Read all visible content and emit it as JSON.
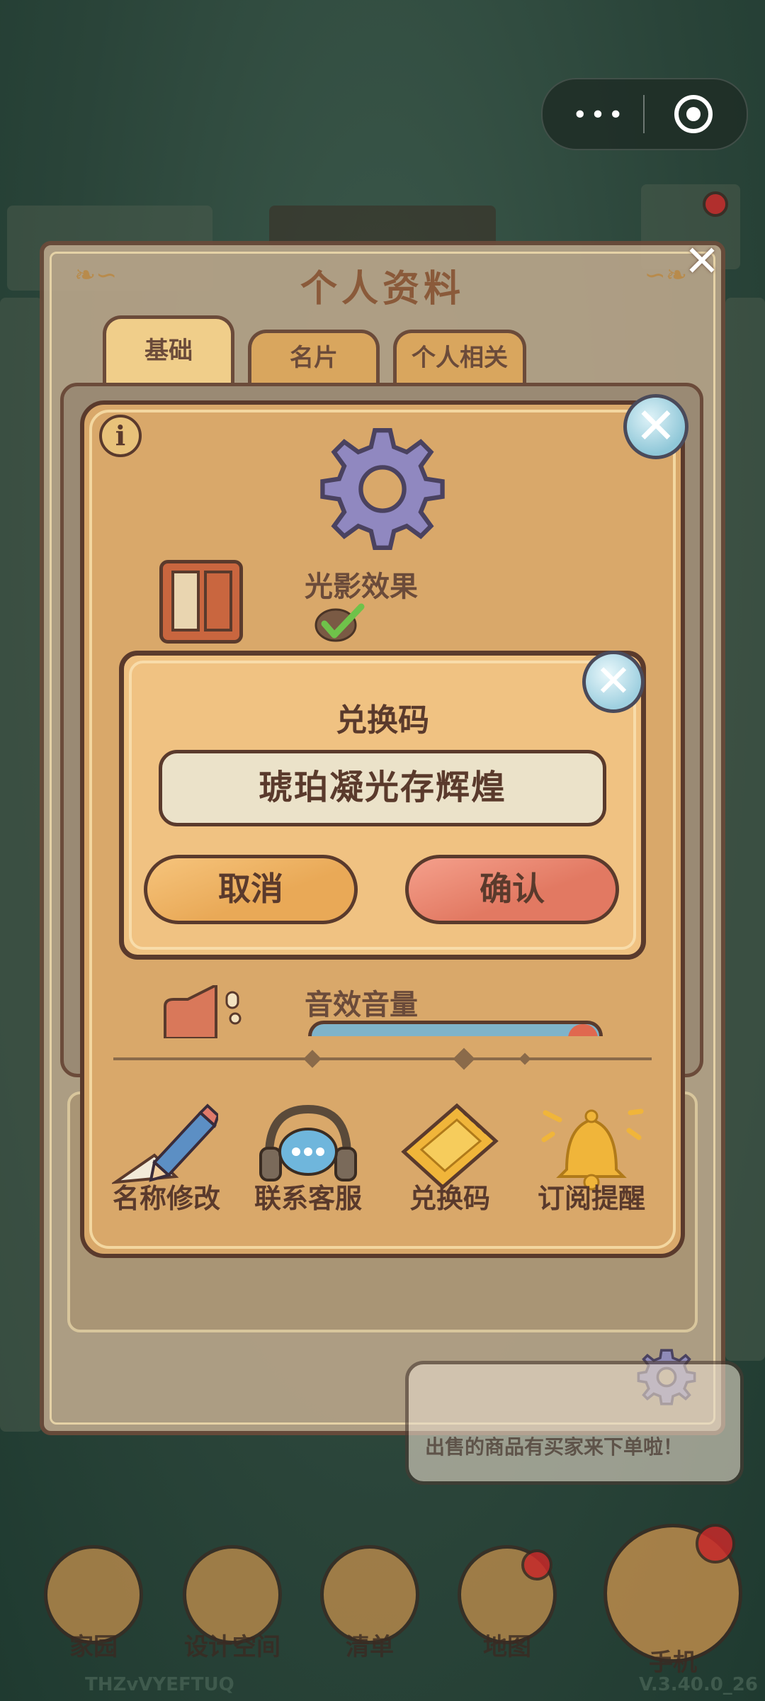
{
  "capsule": {
    "menu_icon": "more-dots-icon",
    "close_icon": "target-icon",
    "dots": "•••"
  },
  "profile": {
    "title": "个人资料",
    "tabs": [
      {
        "label": "基础",
        "active": true
      },
      {
        "label": "名片",
        "active": false
      },
      {
        "label": "个人相关",
        "active": false
      }
    ]
  },
  "settings": {
    "light_label": "光影效果",
    "light_enabled": true,
    "sound_label": "音效音量",
    "sound_volume_percent": 95,
    "features": [
      {
        "label": "名称修改",
        "icon": "pencil-icon"
      },
      {
        "label": "联系客服",
        "icon": "headset-icon"
      },
      {
        "label": "兑换码",
        "icon": "ticket-icon"
      },
      {
        "label": "订阅提醒",
        "icon": "bell-icon"
      }
    ]
  },
  "redeem": {
    "title": "兑换码",
    "code_value": "琥珀凝光存辉煌",
    "cancel_label": "取消",
    "confirm_label": "确认"
  },
  "bubble": {
    "text": "出售的商品有买家来下单啦！"
  },
  "bottom_nav": [
    {
      "label": "家园",
      "icon": "home-icon"
    },
    {
      "label": "设计空间",
      "icon": "design-icon"
    },
    {
      "label": "清单",
      "icon": "list-icon"
    },
    {
      "label": "地图",
      "icon": "map-pin-icon"
    },
    {
      "label": "手机",
      "icon": "phone-icon"
    }
  ],
  "footer": {
    "id_text": "THZvVYEFTUQ",
    "version": "V.3.40.0_26"
  },
  "colors": {
    "panel_border": "#5a3a2c",
    "cancel": "#e9a957",
    "confirm": "#e27962",
    "gear": "#9088c0"
  }
}
